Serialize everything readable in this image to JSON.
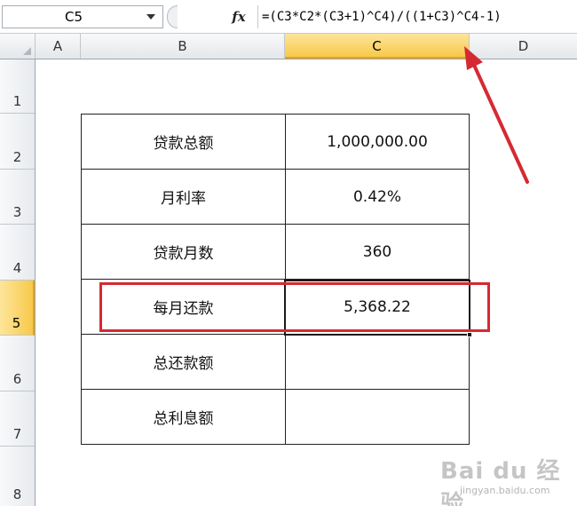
{
  "formula_bar": {
    "name_box": "C5",
    "fx_label": "fx",
    "formula": "=(C3*C2*(C3+1)^C4)/((1+C3)^C4-1)"
  },
  "columns": [
    "A",
    "B",
    "C",
    "D"
  ],
  "selected_column": "C",
  "rows": [
    "1",
    "2",
    "3",
    "4",
    "5",
    "6",
    "7",
    "8"
  ],
  "selected_row": "5",
  "table": [
    {
      "label": "贷款总额",
      "value": "1,000,000.00"
    },
    {
      "label": "月利率",
      "value": "0.42%"
    },
    {
      "label": "贷款月数",
      "value": "360"
    },
    {
      "label": "每月还款",
      "value": "5,368.22"
    },
    {
      "label": "总还款额",
      "value": ""
    },
    {
      "label": "总利息额",
      "value": ""
    }
  ],
  "colors": {
    "highlight": "#d52a32",
    "arrow": "#d52a32",
    "selected_header": "#f7c94a"
  },
  "watermark": {
    "logo": "Bai du 经验",
    "url": "jingyan.baidu.com"
  }
}
